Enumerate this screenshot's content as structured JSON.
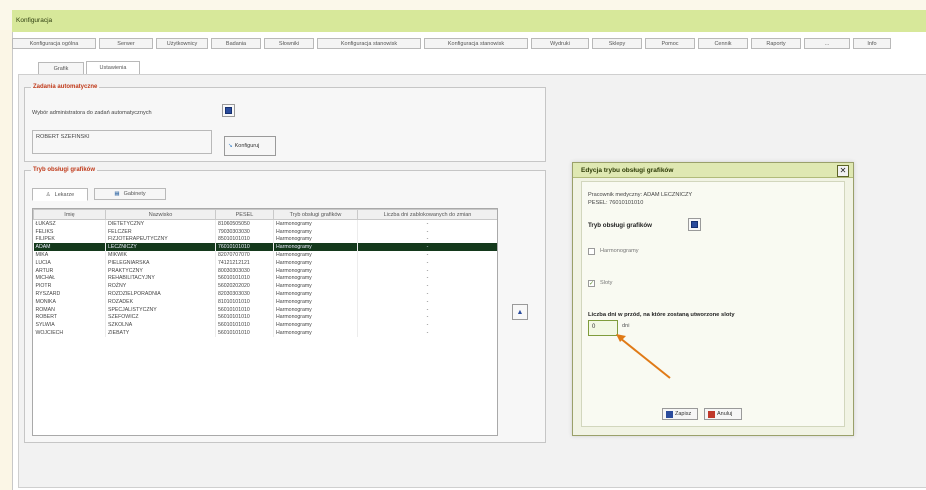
{
  "window": {
    "title": "Konfiguracja"
  },
  "menu": {
    "label": "Konfiguracja"
  },
  "top_tabs": [
    "Konfiguracja ogólna",
    "Serwer",
    "Użytkownicy",
    "Badania",
    "Słowniki",
    "Konfiguracja stanowisk",
    "Konfiguracja stanowisk",
    "Wydruki",
    "Sklepy",
    "Pomoc",
    "Cennik",
    "Raporty",
    "...",
    "Info"
  ],
  "sub_tabs": [
    "Grafik",
    "Ustawienia"
  ],
  "auto_orders": {
    "legend": "Zadania automatyczne",
    "label": "Wybór administratora do zadań automatycznych",
    "value": "ROBERT SZEFINSKI",
    "config_button": "Konfiguruj"
  },
  "schedule": {
    "legend": "Tryb obsługi grafików",
    "tabs": [
      "Lekarze",
      "Gabinety"
    ],
    "columns": [
      "Imię",
      "Nazwisko",
      "PESEL",
      "Tryb obsługi grafików",
      "Liczba dni zablokowanych do zmian"
    ],
    "rows": [
      {
        "first": "ŁUKASZ",
        "last": "DIETETYCZNY",
        "pesel": "81060505050",
        "mode": "Harmonogramy",
        "days": "-"
      },
      {
        "first": "FELIKS",
        "last": "FELCZER",
        "pesel": "79030303030",
        "mode": "Harmonogramy",
        "days": "-"
      },
      {
        "first": "FILIPEK",
        "last": "FIZJOTERAPEUTYCZNY",
        "pesel": "85010101010",
        "mode": "Harmonogramy",
        "days": "-"
      },
      {
        "first": "ADAM",
        "last": "LECZNICZY",
        "pesel": "76010101010",
        "mode": "Harmonogramy",
        "days": "-"
      },
      {
        "first": "MIKA",
        "last": "MIKWIK",
        "pesel": "82070707070",
        "mode": "Harmonogramy",
        "days": "-"
      },
      {
        "first": "LUCIA",
        "last": "PIELEGNIARSKA",
        "pesel": "74121212121",
        "mode": "Harmonogramy",
        "days": "-"
      },
      {
        "first": "ARTUR",
        "last": "PRAKTYCZNY",
        "pesel": "80030303030",
        "mode": "Harmonogramy",
        "days": "-"
      },
      {
        "first": "MICHAŁ",
        "last": "REHABILITACYJNY",
        "pesel": "56010101010",
        "mode": "Harmonogramy",
        "days": "-"
      },
      {
        "first": "PIOTR",
        "last": "ROŻNY",
        "pesel": "56020202020",
        "mode": "Harmonogramy",
        "days": "-"
      },
      {
        "first": "RYSZARD",
        "last": "ROZDZIELPORADNIA",
        "pesel": "82030303030",
        "mode": "Harmonogramy",
        "days": "-"
      },
      {
        "first": "MONIKA",
        "last": "ROZADEK",
        "pesel": "81010101010",
        "mode": "Harmonogramy",
        "days": "-"
      },
      {
        "first": "ROMAN",
        "last": "SPECJALISTYCZNY",
        "pesel": "56010101010",
        "mode": "Harmonogramy",
        "days": "-"
      },
      {
        "first": "ROBERT",
        "last": "SZEFOWICZ",
        "pesel": "56010101010",
        "mode": "Harmonogramy",
        "days": "-"
      },
      {
        "first": "SYLWIA",
        "last": "SZKOLNA",
        "pesel": "56010101010",
        "mode": "Harmonogramy",
        "days": "-"
      },
      {
        "first": "WOJCIECH",
        "last": "ZIEBATY",
        "pesel": "56010101010",
        "mode": "Harmonogramy",
        "days": "-"
      }
    ],
    "selected_row": 3
  },
  "dialog": {
    "title": "Edycja trybu obsługi grafików",
    "employee": "Pracownik medyczny: ADAM LECZNICZY",
    "pesel": "PESEL: 76010101010",
    "mode_label": "Tryb obsługi grafików",
    "opt_harmonogramy": "Harmonogramy",
    "opt_sloty": "Sloty",
    "days_label": "Liczba dni w przód, na które zostaną utworzone sloty",
    "days_value": "0",
    "days_unit": "dni",
    "save": "Zapisz",
    "cancel": "Anuluj"
  },
  "colors": {
    "accent": "#c03a1a",
    "header_green": "#d7e89a",
    "selection": "#14391c",
    "arrow": "#e07a17"
  }
}
